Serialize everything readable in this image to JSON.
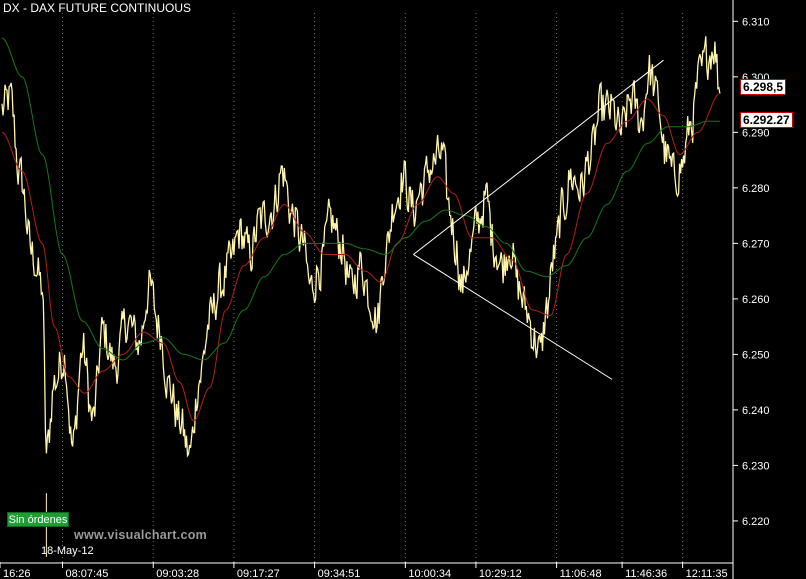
{
  "header": {
    "title": "DX - DAX FUTURE CONTINUOUS"
  },
  "status": {
    "badge": "Sin órdenes"
  },
  "watermark": {
    "text": "www.visualchart.com"
  },
  "session_date": "18-May-12",
  "last_prices": {
    "close": "6.298,5",
    "moving_average": "6.292.27"
  },
  "colors": {
    "price": "#fff4a8",
    "ma_fast": "#b0201a",
    "ma_slow": "#137a16",
    "trendline": "#ffffff",
    "badge": "#1f9c33",
    "grid": "#6e6e6e"
  },
  "chart_data": {
    "type": "line",
    "title": "DX - DAX FUTURE CONTINUOUS",
    "xlabel": "",
    "ylabel": "",
    "ylim": [
      6.2135,
      6.3115
    ],
    "y_ticks": [
      "6.310",
      "6.300",
      "6.290",
      "6.280",
      "6.270",
      "6.260",
      "6.250",
      "6.240",
      "6.230",
      "6.220"
    ],
    "x_ticks": [
      "16:26",
      "08:07:45",
      "09:03:28",
      "09:17:27",
      "09:34:51",
      "10:00:34",
      "10:29:12",
      "11:06:48",
      "11:46:36",
      "12:11:35"
    ],
    "x_tick_index": [
      0,
      60,
      150,
      230,
      310,
      400,
      470,
      550,
      615,
      675
    ],
    "n_points": 720,
    "grid": "vertical dashed",
    "series": [
      {
        "name": "",
        "anchors": [
          [
            0,
            6.294
          ],
          [
            8,
            6.296
          ],
          [
            18,
            6.282
          ],
          [
            30,
            6.268
          ],
          [
            40,
            6.262
          ],
          [
            44,
            6.232
          ],
          [
            52,
            6.245
          ],
          [
            62,
            6.25
          ],
          [
            70,
            6.233
          ],
          [
            80,
            6.251
          ],
          [
            90,
            6.238
          ],
          [
            100,
            6.254
          ],
          [
            112,
            6.248
          ],
          [
            124,
            6.256
          ],
          [
            136,
            6.252
          ],
          [
            146,
            6.262
          ],
          [
            156,
            6.255
          ],
          [
            166,
            6.244
          ],
          [
            176,
            6.238
          ],
          [
            186,
            6.232
          ],
          [
            196,
            6.246
          ],
          [
            206,
            6.256
          ],
          [
            216,
            6.262
          ],
          [
            226,
            6.266
          ],
          [
            236,
            6.272
          ],
          [
            246,
            6.268
          ],
          [
            256,
            6.274
          ],
          [
            268,
            6.276
          ],
          [
            278,
            6.283
          ],
          [
            288,
            6.275
          ],
          [
            298,
            6.27
          ],
          [
            306,
            6.262
          ],
          [
            316,
            6.266
          ],
          [
            326,
            6.274
          ],
          [
            336,
            6.27
          ],
          [
            346,
            6.262
          ],
          [
            356,
            6.266
          ],
          [
            366,
            6.26
          ],
          [
            372,
            6.256
          ],
          [
            380,
            6.268
          ],
          [
            390,
            6.278
          ],
          [
            398,
            6.282
          ],
          [
            408,
            6.276
          ],
          [
            416,
            6.28
          ],
          [
            426,
            6.284
          ],
          [
            436,
            6.286
          ],
          [
            444,
            6.276
          ],
          [
            450,
            6.27
          ],
          [
            456,
            6.262
          ],
          [
            464,
            6.268
          ],
          [
            472,
            6.274
          ],
          [
            480,
            6.278
          ],
          [
            488,
            6.27
          ],
          [
            496,
            6.266
          ],
          [
            504,
            6.27
          ],
          [
            512,
            6.262
          ],
          [
            520,
            6.258
          ],
          [
            528,
            6.253
          ],
          [
            534,
            6.25
          ],
          [
            540,
            6.258
          ],
          [
            548,
            6.268
          ],
          [
            556,
            6.276
          ],
          [
            564,
            6.282
          ],
          [
            574,
            6.28
          ],
          [
            584,
            6.286
          ],
          [
            594,
            6.294
          ],
          [
            604,
            6.294
          ],
          [
            614,
            6.29
          ],
          [
            624,
            6.296
          ],
          [
            634,
            6.292
          ],
          [
            642,
            6.301
          ],
          [
            650,
            6.296
          ],
          [
            658,
            6.286
          ],
          [
            666,
            6.282
          ],
          [
            674,
            6.284
          ],
          [
            684,
            6.292
          ],
          [
            692,
            6.3
          ],
          [
            700,
            6.304
          ],
          [
            706,
            6.306
          ],
          [
            712,
            6.298
          ]
        ]
      },
      {
        "name": "",
        "anchors": [
          [
            0,
            6.29
          ],
          [
            20,
            6.283
          ],
          [
            40,
            6.27
          ],
          [
            52,
            6.255
          ],
          [
            66,
            6.246
          ],
          [
            82,
            6.243
          ],
          [
            100,
            6.247
          ],
          [
            120,
            6.25
          ],
          [
            140,
            6.254
          ],
          [
            160,
            6.252
          ],
          [
            176,
            6.245
          ],
          [
            190,
            6.238
          ],
          [
            206,
            6.244
          ],
          [
            222,
            6.258
          ],
          [
            240,
            6.266
          ],
          [
            260,
            6.271
          ],
          [
            280,
            6.277
          ],
          [
            300,
            6.272
          ],
          [
            320,
            6.268
          ],
          [
            340,
            6.268
          ],
          [
            360,
            6.265
          ],
          [
            376,
            6.263
          ],
          [
            392,
            6.27
          ],
          [
            412,
            6.277
          ],
          [
            432,
            6.282
          ],
          [
            448,
            6.279
          ],
          [
            466,
            6.271
          ],
          [
            486,
            6.271
          ],
          [
            506,
            6.267
          ],
          [
            526,
            6.258
          ],
          [
            544,
            6.257
          ],
          [
            560,
            6.268
          ],
          [
            580,
            6.279
          ],
          [
            600,
            6.288
          ],
          [
            620,
            6.292
          ],
          [
            640,
            6.296
          ],
          [
            656,
            6.293
          ],
          [
            672,
            6.286
          ],
          [
            690,
            6.29
          ],
          [
            712,
            6.297
          ]
        ]
      },
      {
        "name": "",
        "anchors": [
          [
            0,
            6.307
          ],
          [
            20,
            6.3
          ],
          [
            40,
            6.286
          ],
          [
            60,
            6.268
          ],
          [
            80,
            6.256
          ],
          [
            100,
            6.251
          ],
          [
            120,
            6.249
          ],
          [
            140,
            6.252
          ],
          [
            160,
            6.253
          ],
          [
            180,
            6.25
          ],
          [
            200,
            6.249
          ],
          [
            220,
            6.252
          ],
          [
            240,
            6.258
          ],
          [
            260,
            6.264
          ],
          [
            280,
            6.268
          ],
          [
            300,
            6.27
          ],
          [
            320,
            6.27
          ],
          [
            340,
            6.27
          ],
          [
            360,
            6.269
          ],
          [
            380,
            6.268
          ],
          [
            400,
            6.271
          ],
          [
            420,
            6.274
          ],
          [
            440,
            6.276
          ],
          [
            460,
            6.275
          ],
          [
            480,
            6.273
          ],
          [
            500,
            6.27
          ],
          [
            520,
            6.265
          ],
          [
            540,
            6.264
          ],
          [
            560,
            6.266
          ],
          [
            580,
            6.271
          ],
          [
            600,
            6.277
          ],
          [
            620,
            6.283
          ],
          [
            640,
            6.288
          ],
          [
            660,
            6.291
          ],
          [
            680,
            6.291
          ],
          [
            700,
            6.292
          ],
          [
            712,
            6.292
          ]
        ]
      }
    ],
    "trendlines": [
      {
        "from": [
          408,
          6.268
        ],
        "to": [
          656,
          6.303
        ]
      },
      {
        "from": [
          408,
          6.268
        ],
        "to": [
          605,
          6.2455
        ]
      }
    ]
  }
}
